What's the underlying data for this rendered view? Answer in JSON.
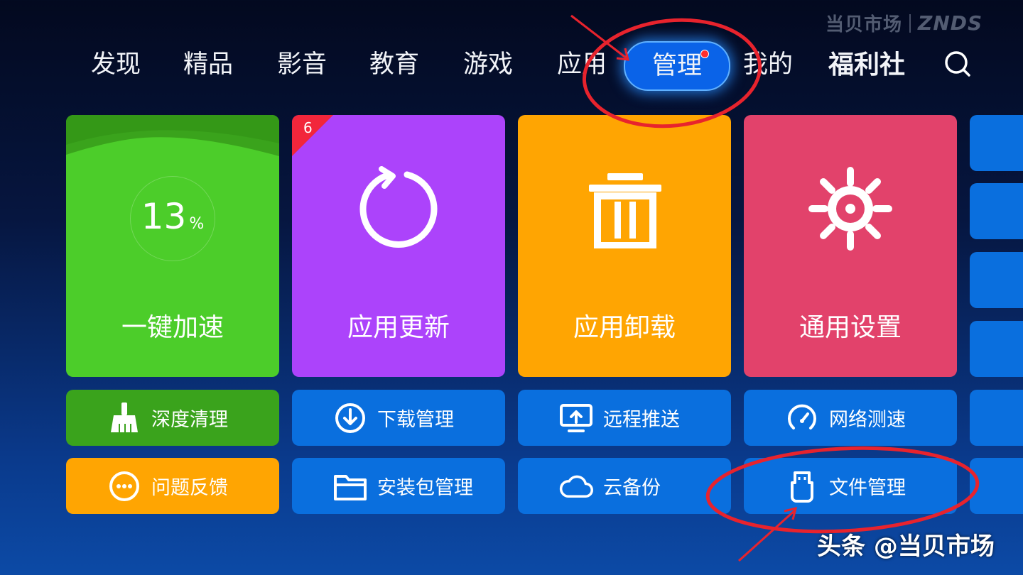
{
  "watermark": {
    "cn": "当贝市场",
    "en": "ZNDS"
  },
  "nav": {
    "items": [
      "发现",
      "精品",
      "影音",
      "教育",
      "游戏",
      "应用",
      "管理",
      "我的",
      "福利社"
    ],
    "active": "管理"
  },
  "tiles": {
    "speedup": {
      "label": "一键加速",
      "percent": "13",
      "percent_sign": "%"
    },
    "update": {
      "label": "应用更新",
      "badge": "6"
    },
    "uninstall": {
      "label": "应用卸载"
    },
    "settings": {
      "label": "通用设置"
    }
  },
  "small_tiles": [
    {
      "label": "深度清理",
      "icon": "broom-icon"
    },
    {
      "label": "下载管理",
      "icon": "download-icon"
    },
    {
      "label": "远程推送",
      "icon": "remote-push-icon"
    },
    {
      "label": "网络测速",
      "icon": "speedometer-icon"
    },
    {
      "label": "问题反馈",
      "icon": "feedback-icon"
    },
    {
      "label": "安装包管理",
      "icon": "folder-icon"
    },
    {
      "label": "云备份",
      "icon": "cloud-icon"
    },
    {
      "label": "文件管理",
      "icon": "usb-drive-icon"
    }
  ],
  "colors": {
    "green": "#4ccd2a",
    "green_dark": "#3aa31c",
    "purple": "#ac43fb",
    "orange": "#ffa502",
    "pink": "#e2426b",
    "blue": "#0a6fde",
    "annotation_red": "#e8232d"
  },
  "footer_watermark": "头条 @当贝市场"
}
